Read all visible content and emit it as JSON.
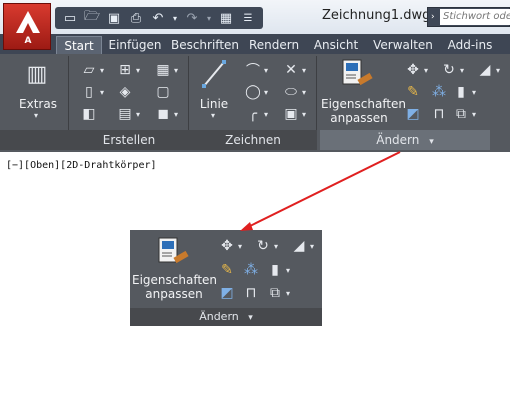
{
  "app": {
    "button_letter": "A",
    "document_title": "Zeichnung1.dwg"
  },
  "search": {
    "placeholder": "Stichwort oder"
  },
  "tabs": [
    {
      "label": "Start",
      "active": true
    },
    {
      "label": "Einfügen"
    },
    {
      "label": "Beschriften"
    },
    {
      "label": "Rendern"
    },
    {
      "label": "Ansicht"
    },
    {
      "label": "Verwalten"
    },
    {
      "label": "Add-ins"
    }
  ],
  "ribbon": {
    "extras_label": "Extras",
    "linie_label": "Linie",
    "eigenschaften_line1": "Eigenschaften",
    "eigenschaften_line2": "anpassen",
    "panels": {
      "erstellen": "Erstellen",
      "zeichnen": "Zeichnen",
      "aendern": "Ändern"
    },
    "dropdown_glyph": "▾"
  },
  "viewport": {
    "label": "[−][Oben][2D-Drahtkörper]"
  },
  "popup": {
    "eigenschaften_line1": "Eigenschaften",
    "eigenschaften_line2": "anpassen",
    "title": "Ändern"
  },
  "colors": {
    "arrow": "#e02020",
    "ribbon_bg": "#55595f",
    "tab_bg": "#3e4654"
  }
}
